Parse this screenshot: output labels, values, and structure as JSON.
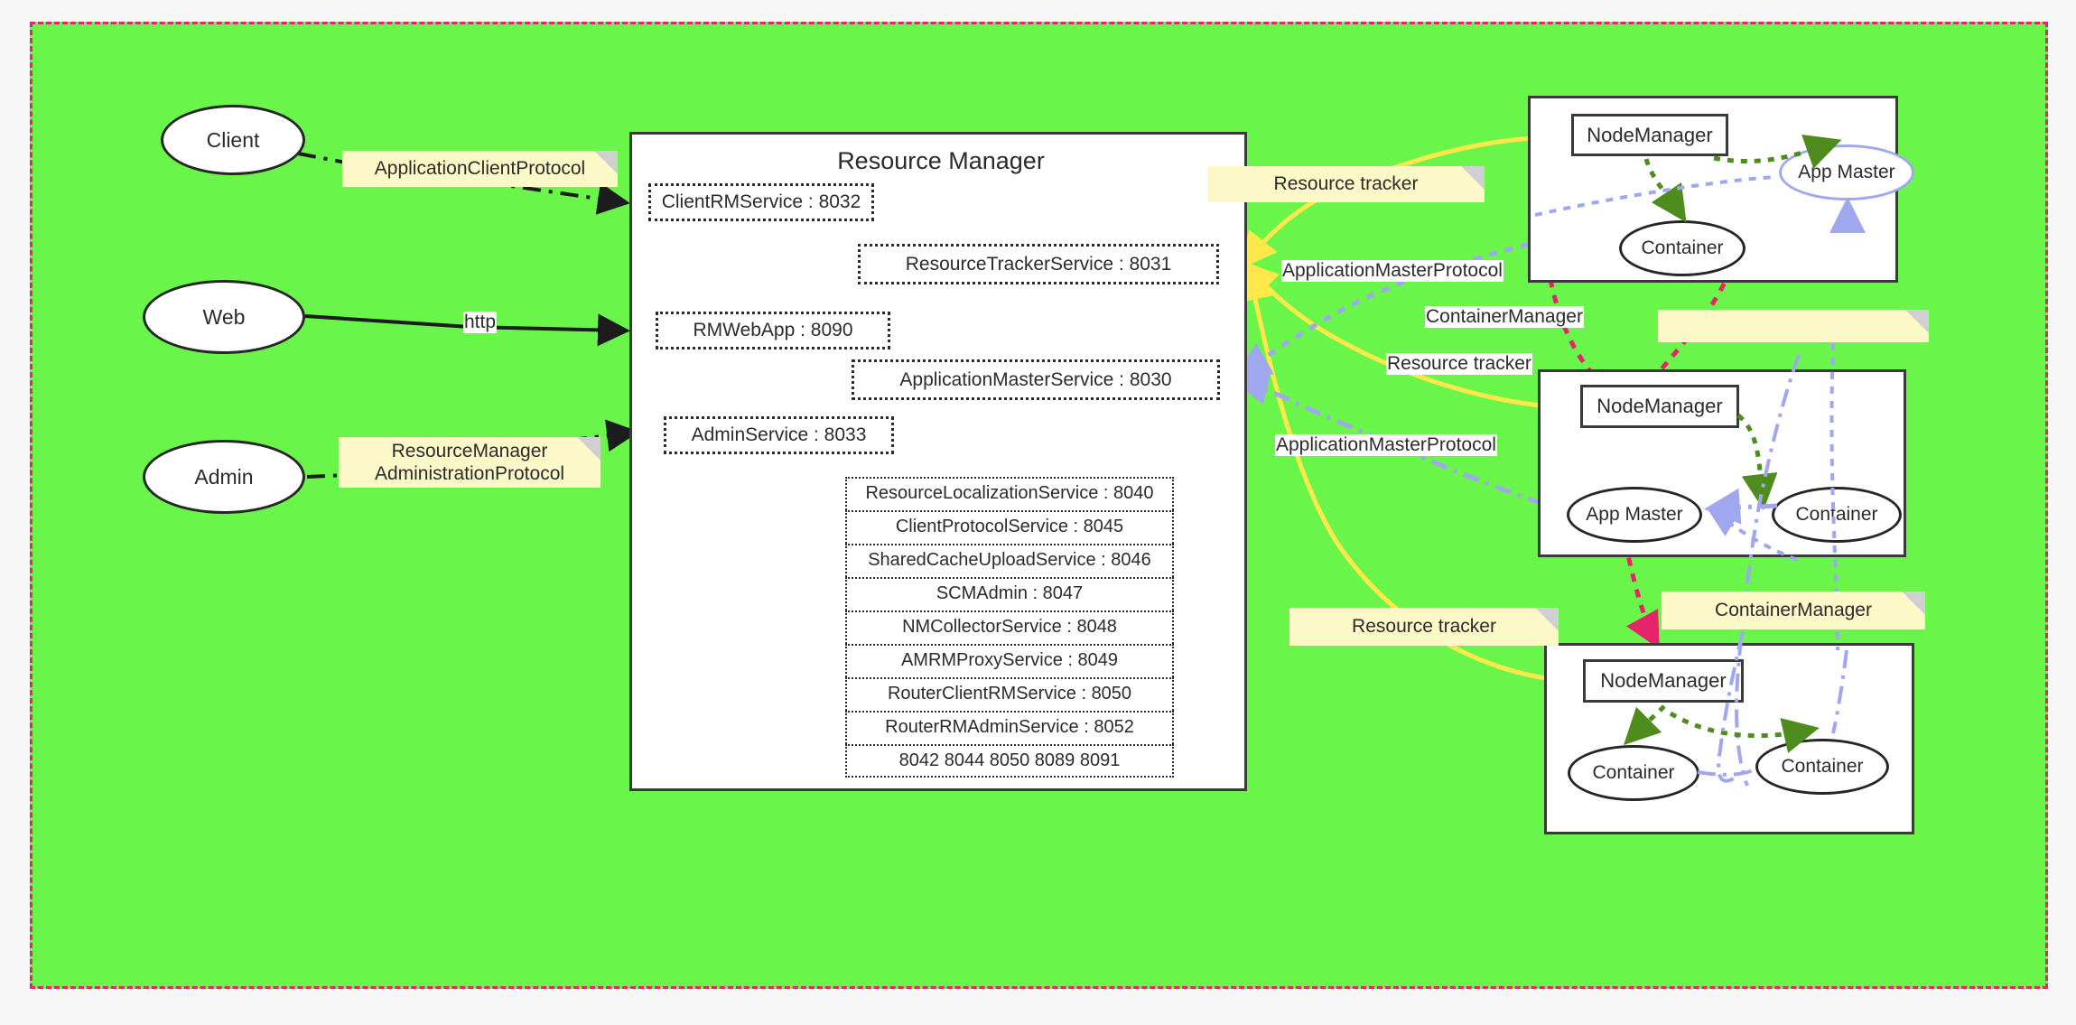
{
  "diagram": {
    "title": "Resource Manager",
    "canvas_color": "#69f54a",
    "border_color": "#e6246b",
    "note_color": "#fcf8c8"
  },
  "actors": [
    {
      "id": "client",
      "label": "Client"
    },
    {
      "id": "web",
      "label": "Web"
    },
    {
      "id": "admin",
      "label": "Admin"
    }
  ],
  "resource_manager": {
    "title": "Resource Manager",
    "entry_services": [
      {
        "name": "ClientRMService : 8032"
      },
      {
        "name": "ResourceTrackerService : 8031"
      },
      {
        "name": "RMWebApp : 8090"
      },
      {
        "name": "ApplicationMasterService : 8030"
      },
      {
        "name": "AdminService : 8033"
      }
    ],
    "service_list": [
      "ResourceLocalizationService : 8040",
      "ClientProtocolService :  8045",
      "SharedCacheUploadService :  8046",
      "SCMAdmin :  8047",
      "NMCollectorService : 8048",
      "AMRMProxyService :  8049",
      "RouterClientRMService :  8050",
      "RouterRMAdminService :  8052",
      "8042 8044  8050 8089 8091"
    ]
  },
  "notes": [
    {
      "id": "note-application-client-protocol",
      "text": "ApplicationClientProtocol"
    },
    {
      "id": "note-rm-administration-protocol",
      "text": "ResourceManager\nAdministrationProtocol"
    },
    {
      "id": "note-resource-tracker-top",
      "text": "Resource tracker"
    },
    {
      "id": "note-blank",
      "text": ""
    },
    {
      "id": "note-resource-tracker-bottom",
      "text": "Resource tracker"
    },
    {
      "id": "note-container-manager-bottom",
      "text": "ContainerManager"
    }
  ],
  "edge_labels": [
    {
      "id": "label-http",
      "text": "http"
    },
    {
      "id": "label-app-master-protocol-1",
      "text": "ApplicationMasterProtocol"
    },
    {
      "id": "label-container-manager-1",
      "text": "ContainerManager"
    },
    {
      "id": "label-resource-tracker-mid",
      "text": "Resource tracker"
    },
    {
      "id": "label-app-master-protocol-2",
      "text": "ApplicationMasterProtocol"
    }
  ],
  "node_panels": [
    {
      "id": "node-panel-1",
      "node_manager": "NodeManager",
      "children": [
        {
          "type": "container",
          "label": "Container"
        },
        {
          "type": "app-master",
          "label": "App Master"
        }
      ]
    },
    {
      "id": "node-panel-2",
      "node_manager": "NodeManager",
      "children": [
        {
          "type": "app-master",
          "label": "App Master"
        },
        {
          "type": "container",
          "label": "Container"
        }
      ]
    },
    {
      "id": "node-panel-3",
      "node_manager": "NodeManager",
      "children": [
        {
          "type": "container",
          "label": "Container"
        },
        {
          "type": "container",
          "label": "Container"
        }
      ]
    }
  ]
}
